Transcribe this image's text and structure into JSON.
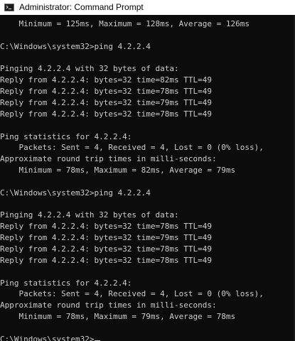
{
  "window": {
    "title": "Administrator: Command Prompt",
    "icon": "cmd-console-icon"
  },
  "console": {
    "lines": [
      "    Minimum = 125ms, Maximum = 128ms, Average = 126ms",
      "",
      "C:\\Windows\\system32>ping 4.2.2.4",
      "",
      "Pinging 4.2.2.4 with 32 bytes of data:",
      "Reply from 4.2.2.4: bytes=32 time=82ms TTL=49",
      "Reply from 4.2.2.4: bytes=32 time=78ms TTL=49",
      "Reply from 4.2.2.4: bytes=32 time=79ms TTL=49",
      "Reply from 4.2.2.4: bytes=32 time=78ms TTL=49",
      "",
      "Ping statistics for 4.2.2.4:",
      "    Packets: Sent = 4, Received = 4, Lost = 0 (0% loss),",
      "Approximate round trip times in milli-seconds:",
      "    Minimum = 78ms, Maximum = 82ms, Average = 79ms",
      "",
      "C:\\Windows\\system32>ping 4.2.2.4",
      "",
      "Pinging 4.2.2.4 with 32 bytes of data:",
      "Reply from 4.2.2.4: bytes=32 time=78ms TTL=49",
      "Reply from 4.2.2.4: bytes=32 time=79ms TTL=49",
      "Reply from 4.2.2.4: bytes=32 time=78ms TTL=49",
      "Reply from 4.2.2.4: bytes=32 time=78ms TTL=49",
      "",
      "Ping statistics for 4.2.2.4:",
      "    Packets: Sent = 4, Received = 4, Lost = 0 (0% loss),",
      "Approximate round trip times in milli-seconds:",
      "    Minimum = 78ms, Maximum = 79ms, Average = 78ms",
      "",
      "C:\\Windows\\system32>"
    ],
    "colors": {
      "background": "#0c0c0c",
      "text": "#cccccc"
    }
  }
}
